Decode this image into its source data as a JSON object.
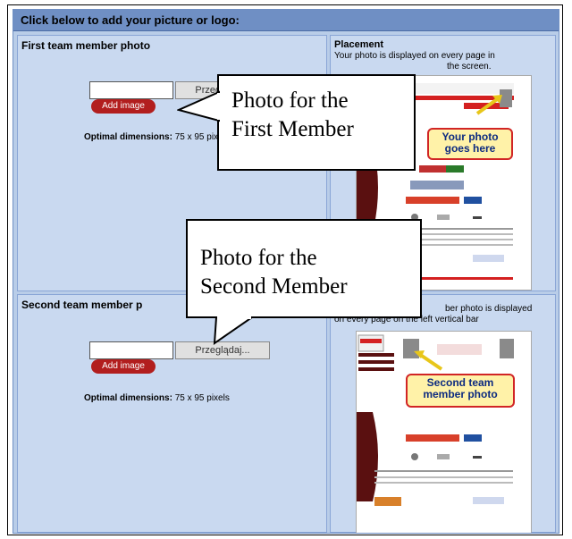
{
  "panel_header": "Click below to add your picture or logo:",
  "first": {
    "title": "First team member photo",
    "browse_label": "Przeglądaj...",
    "add_label": "Add image",
    "optimal_label": "Optimal dimensions:",
    "optimal_value": "75 x 95 pixels"
  },
  "placement": {
    "title": "Placement",
    "desc_line1": "Your photo is displayed on every page in",
    "desc_line2": "the screen.",
    "balloon_line1": "Your photo",
    "balloon_line2": "goes here"
  },
  "second": {
    "title": "Second team member p",
    "browse_label": "Przeglądaj...",
    "add_label": "Add image",
    "optimal_label": "Optimal dimensions:",
    "optimal_value": "75 x 95 pixels"
  },
  "placement2": {
    "desc_line1": "ber photo is displayed",
    "desc_line2": "on every page on the left vertical bar",
    "balloon_line1": "Second team",
    "balloon_line2": "member photo"
  },
  "callout1": {
    "line1": "Photo for the",
    "line2": "First Member"
  },
  "callout2": {
    "line1": "Photo for the",
    "line2": "Second Member"
  }
}
